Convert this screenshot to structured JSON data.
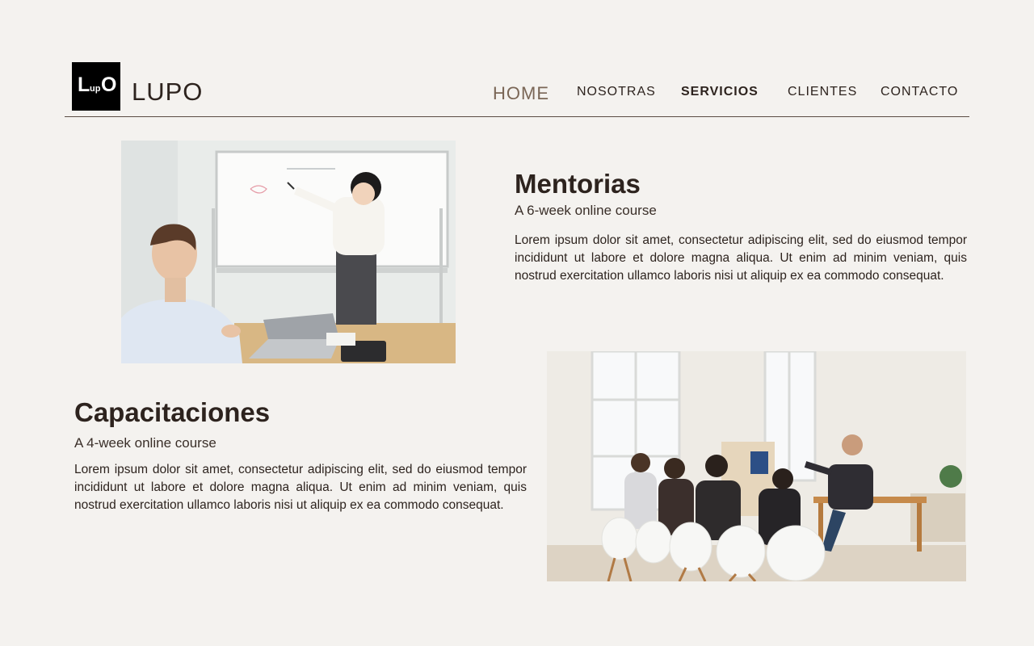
{
  "brand": {
    "logo_text_big": "L",
    "logo_text_small": "up",
    "logo_text_o": "O",
    "name": "LUPO"
  },
  "nav": {
    "home": "HOME",
    "nosotras": "NOSOTRAS",
    "servicios": "SERVICIOS",
    "clientes": "CLIENTES",
    "contacto": "CONTACTO",
    "active": "SERVICIOS"
  },
  "services": [
    {
      "title": "Mentorias",
      "subtitle": "A 6-week online course",
      "body": "Lorem ipsum dolor sit amet, consectetur adipiscing elit, sed do eiusmod tempor incididunt ut labore et dolore magna aliqua. Ut enim ad minim veniam, quis nostrud exercitation ullamco laboris nisi ut aliquip ex ea commodo consequat."
    },
    {
      "title": "Capacitaciones",
      "subtitle": "A 4-week online course",
      "body": "Lorem ipsum dolor sit amet, consectetur adipiscing elit, sed do eiusmod tempor incididunt ut labore et dolore magna aliqua. Ut enim ad minim veniam, quis nostrud exercitation ullamco laboris nisi ut aliquip ex ea commodo consequat."
    }
  ],
  "colors": {
    "background": "#f4f2ef",
    "text": "#2d231e",
    "home_accent": "#7a6656"
  }
}
